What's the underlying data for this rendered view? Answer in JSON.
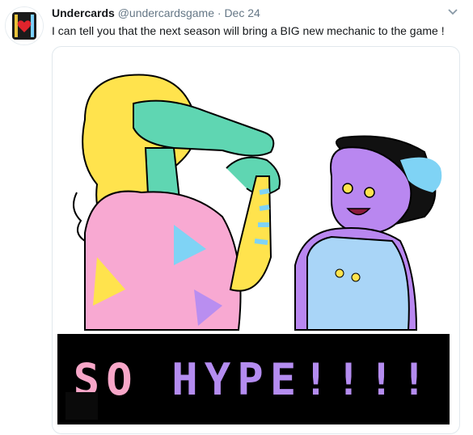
{
  "tweet": {
    "display_name": "Undercards",
    "handle": "@undercardsgame",
    "separator": "·",
    "date": "Dec 24",
    "text": "I can tell you that the next season will bring a BIG new mechanic to the game !",
    "avatar_icon": "heart-card-icon",
    "menu_icon": "chevron-down-icon"
  },
  "image": {
    "banner_word_1": "SO",
    "banner_word_2": "HYPE!!!!",
    "colors": {
      "banner_bg": "#000000",
      "word_1": "#f7a6c8",
      "word_2": "#b48cf0",
      "crocodile": "#5fd6b2",
      "cat": "#b987f0",
      "hair": "#ffe34d"
    }
  }
}
